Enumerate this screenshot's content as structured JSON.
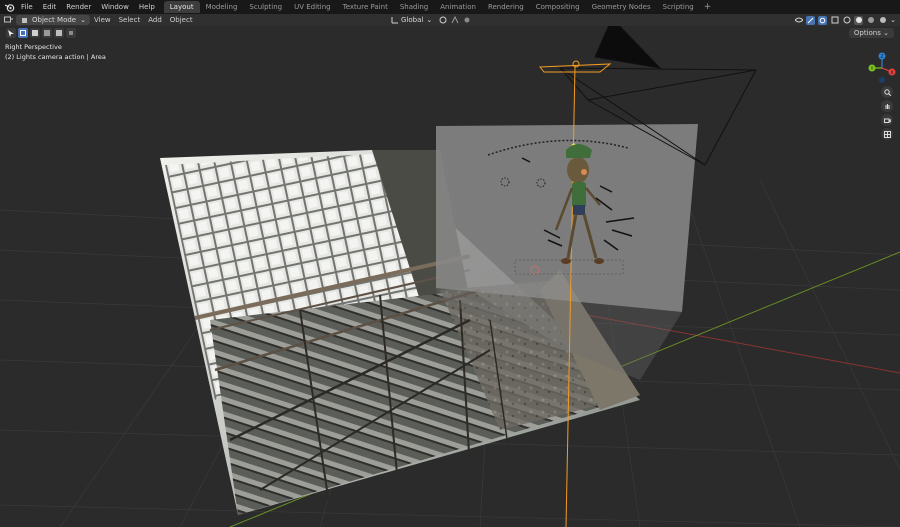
{
  "menu": {
    "items": [
      "File",
      "Edit",
      "Render",
      "Window",
      "Help"
    ]
  },
  "workspaces": {
    "tabs": [
      "Layout",
      "Modeling",
      "Sculpting",
      "UV Editing",
      "Texture Paint",
      "Shading",
      "Animation",
      "Rendering",
      "Compositing",
      "Geometry Nodes",
      "Scripting"
    ],
    "active": "Layout",
    "add_label": "+"
  },
  "header": {
    "mode": "Object Mode",
    "view": "View",
    "select": "Select",
    "add": "Add",
    "object": "Object",
    "orientation": "Global",
    "options": "Options"
  },
  "viewport": {
    "perspective": "Right Perspective",
    "collection": "(2) Lights camera action | Area"
  },
  "gizmo": {
    "x_label": "X",
    "y_label": "Y",
    "z_label": "Z"
  },
  "icons": {
    "logo": "blender-logo-icon",
    "select": "select-box-icon",
    "zoom": "zoom-icon",
    "pan": "hand-pan-icon",
    "camera": "camera-view-icon",
    "grid": "ortho-grid-icon"
  },
  "colors": {
    "accent": "#4772b3",
    "x_axis": "#e0433f",
    "y_axis": "#7ec31e",
    "z_axis": "#2f83d4",
    "selection": "#f59b22"
  }
}
